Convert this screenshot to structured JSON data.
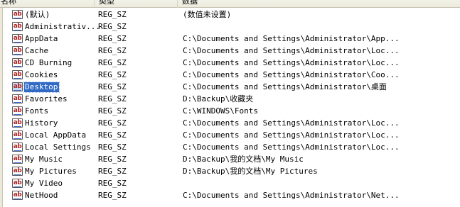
{
  "columns": {
    "name": "名称",
    "type": "类型",
    "data": "数据"
  },
  "icon_text": "ab",
  "rows": [
    {
      "name": "(默认)",
      "type": "REG_SZ",
      "data": "(数值未设置)",
      "selected": false
    },
    {
      "name": "Administrativ...",
      "type": "REG_SZ",
      "data": "",
      "selected": false
    },
    {
      "name": "AppData",
      "type": "REG_SZ",
      "data": "C:\\Documents and Settings\\Administrator\\App...",
      "selected": false
    },
    {
      "name": "Cache",
      "type": "REG_SZ",
      "data": "C:\\Documents and Settings\\Administrator\\Loc...",
      "selected": false
    },
    {
      "name": "CD Burning",
      "type": "REG_SZ",
      "data": "C:\\Documents and Settings\\Administrator\\Loc...",
      "selected": false
    },
    {
      "name": "Cookies",
      "type": "REG_SZ",
      "data": "C:\\Documents and Settings\\Administrator\\Coo...",
      "selected": false
    },
    {
      "name": "Desktop",
      "type": "REG_SZ",
      "data": "C:\\Documents and Settings\\Administrator\\桌面",
      "selected": true
    },
    {
      "name": "Favorites",
      "type": "REG_SZ",
      "data": "D:\\Backup\\收藏夹",
      "selected": false
    },
    {
      "name": "Fonts",
      "type": "REG_SZ",
      "data": "C:\\WINDOWS\\Fonts",
      "selected": false
    },
    {
      "name": "History",
      "type": "REG_SZ",
      "data": "C:\\Documents and Settings\\Administrator\\Loc...",
      "selected": false
    },
    {
      "name": "Local AppData",
      "type": "REG_SZ",
      "data": "C:\\Documents and Settings\\Administrator\\Loc...",
      "selected": false
    },
    {
      "name": "Local Settings",
      "type": "REG_SZ",
      "data": "C:\\Documents and Settings\\Administrator\\Loc...",
      "selected": false
    },
    {
      "name": "My Music",
      "type": "REG_SZ",
      "data": "D:\\Backup\\我的文档\\My Music",
      "selected": false
    },
    {
      "name": "My Pictures",
      "type": "REG_SZ",
      "data": "D:\\Backup\\我的文档\\My Pictures",
      "selected": false
    },
    {
      "name": "My Video",
      "type": "REG_SZ",
      "data": "",
      "selected": false
    },
    {
      "name": "NetHood",
      "type": "REG_SZ",
      "data": "C:\\Documents and Settings\\Administrator\\Net...",
      "selected": false
    }
  ]
}
